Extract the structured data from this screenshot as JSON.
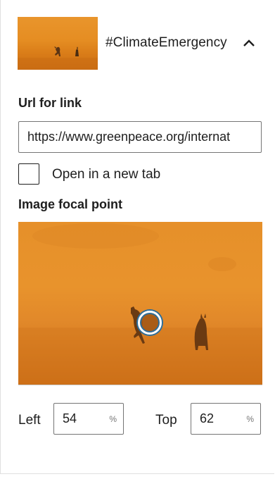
{
  "header": {
    "title": "#ClimateEmergency",
    "collapse_icon": "chevron-up-icon"
  },
  "link": {
    "label": "Url for link",
    "value": "https://www.greenpeace.org/internat"
  },
  "new_tab": {
    "label": "Open in a new tab",
    "checked": false
  },
  "focal_point": {
    "label": "Image focal point",
    "left": {
      "label": "Left",
      "value": "54",
      "unit": "%"
    },
    "top": {
      "label": "Top",
      "value": "62",
      "unit": "%"
    }
  },
  "colors": {
    "image_orange": "#e58d22",
    "handle_ring": "#2a6e9e"
  }
}
